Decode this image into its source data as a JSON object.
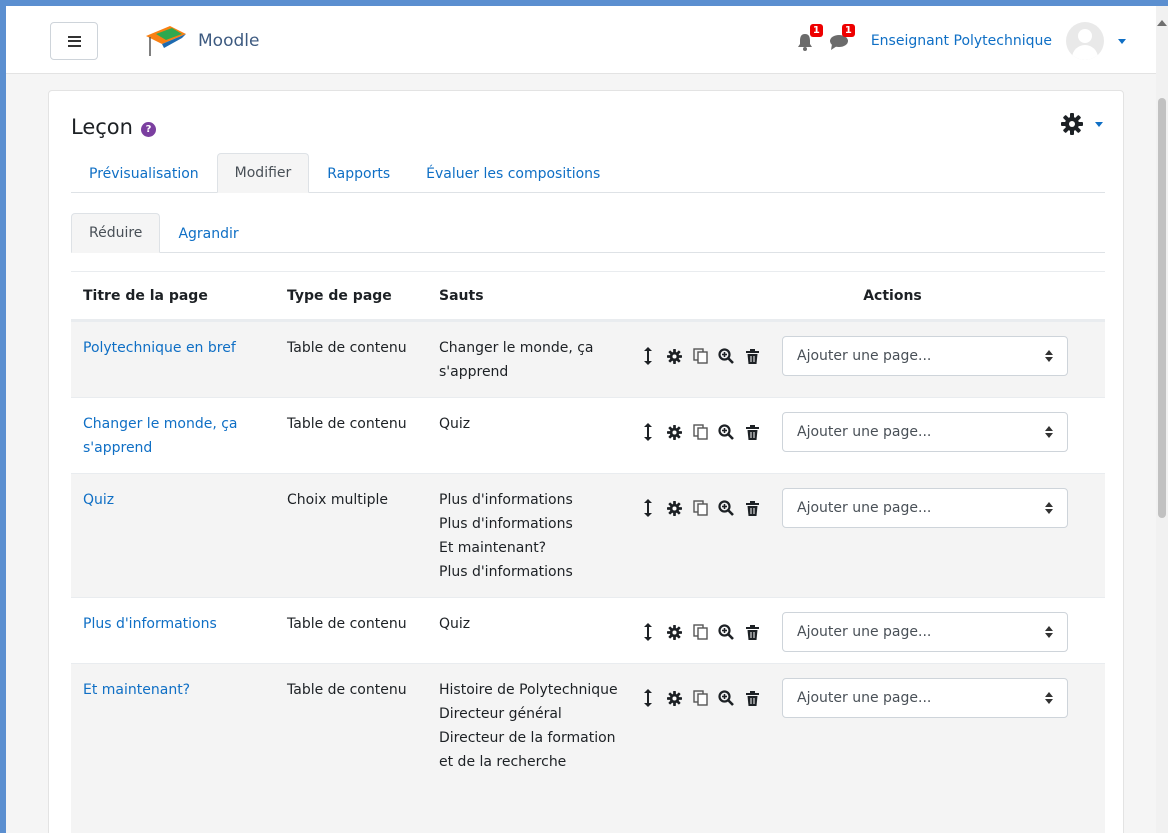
{
  "app": {
    "name": "Moodle"
  },
  "header": {
    "menu_label": "Menu",
    "notifications_count": "1",
    "messages_count": "1",
    "user_name": "Enseignant Polytechnique"
  },
  "page": {
    "title": "Leçon",
    "help_glyph": "?"
  },
  "tabs": [
    {
      "label": "Prévisualisation",
      "active": false
    },
    {
      "label": "Modifier",
      "active": true
    },
    {
      "label": "Rapports",
      "active": false
    },
    {
      "label": "Évaluer les compositions",
      "active": false
    }
  ],
  "subtabs": [
    {
      "label": "Réduire",
      "active": true
    },
    {
      "label": "Agrandir",
      "active": false
    }
  ],
  "table": {
    "headers": [
      "Titre de la page",
      "Type de page",
      "Sauts",
      "Actions"
    ],
    "select_placeholder": "Ajouter une page...",
    "rows": [
      {
        "title": "Polytechnique en bref",
        "type": "Table de contenu",
        "jumps": [
          "Changer le monde, ça s'apprend"
        ]
      },
      {
        "title": "Changer le monde, ça s'apprend",
        "type": "Table de contenu",
        "jumps": [
          "Quiz"
        ]
      },
      {
        "title": "Quiz",
        "type": "Choix multiple",
        "jumps": [
          "Plus d'informations",
          "Plus d'informations",
          "Et maintenant?",
          "Plus d'informations"
        ]
      },
      {
        "title": "Plus d'informations",
        "type": "Table de contenu",
        "jumps": [
          "Quiz"
        ]
      },
      {
        "title": "Et maintenant?",
        "type": "Table de contenu",
        "jumps": [
          "Histoire de Polytechnique",
          "Directeur général",
          "Directeur de la formation et de la recherche"
        ]
      }
    ]
  },
  "icons": {
    "move": "move-icon",
    "edit": "gear-icon",
    "copy": "copy-icon",
    "preview": "zoom-icon",
    "delete": "trash-icon"
  },
  "colors": {
    "link": "#0f6fc5",
    "badge": "#e00000",
    "help": "#7b3fa0"
  }
}
